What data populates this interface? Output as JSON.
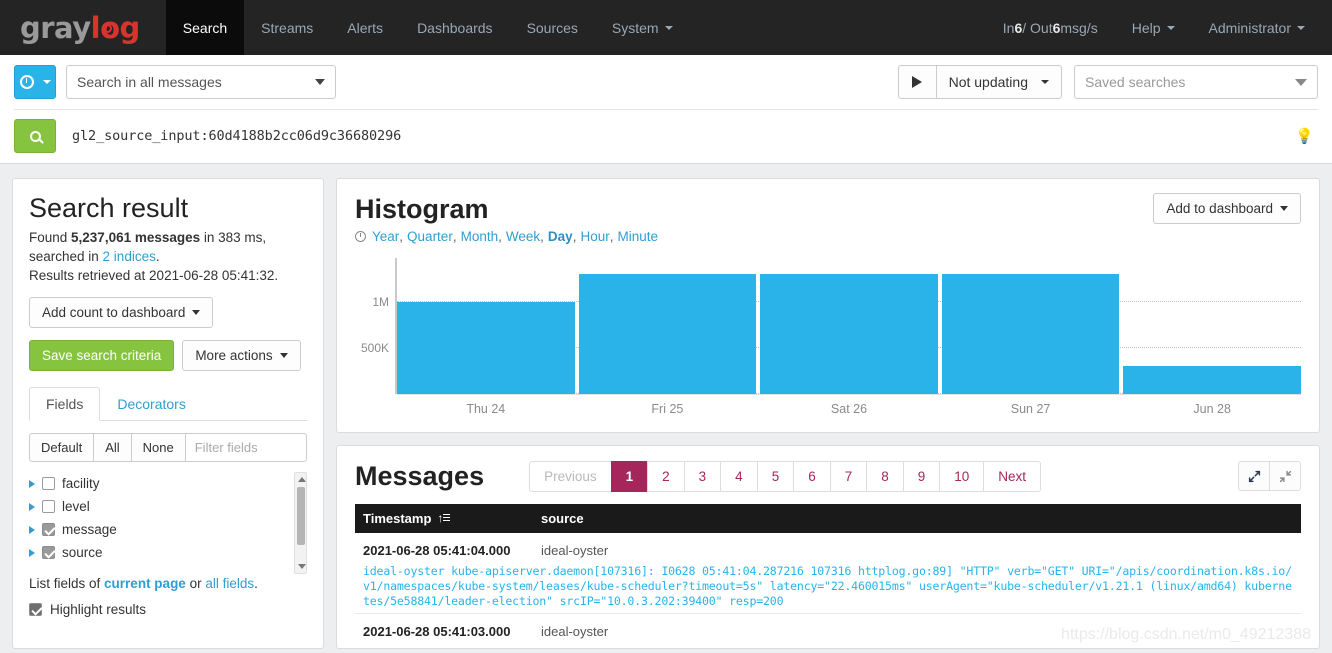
{
  "navbar": {
    "brand": "graylog",
    "brand_part1": "gray",
    "brand_part2": "log",
    "links": [
      {
        "label": "Search",
        "active": true
      },
      {
        "label": "Streams",
        "active": false
      },
      {
        "label": "Alerts",
        "active": false
      },
      {
        "label": "Dashboards",
        "active": false
      },
      {
        "label": "Sources",
        "active": false
      },
      {
        "label": "System",
        "active": false,
        "caret": true
      }
    ],
    "throughput_prefix": "In ",
    "throughput_in": "6",
    "throughput_mid": " / Out ",
    "throughput_out": "6",
    "throughput_suffix": " msg/s",
    "help": "Help",
    "user": "Administrator"
  },
  "search": {
    "time_range_label": "time-range-selector",
    "scope_value": "Search in all messages",
    "query_value": "gl2_source_input:60d4188b2cc06d9c36680296",
    "refresh_label": "Not updating",
    "saved_searches_placeholder": "Saved searches"
  },
  "sidebar": {
    "title": "Search result",
    "found_prefix": "Found ",
    "found_count": "5,237,061 messages",
    "found_mid": " in 383 ms, searched in ",
    "indices_link": "2 indices",
    "found_suffix": ".",
    "retrieved": "Results retrieved at 2021-06-28 05:41:32.",
    "add_count_button": "Add count to dashboard",
    "save_button": "Save search criteria",
    "more_actions_button": "More actions",
    "tabs": [
      {
        "label": "Fields",
        "active": true
      },
      {
        "label": "Decorators",
        "active": false
      }
    ],
    "field_controls": [
      "Default",
      "All",
      "None"
    ],
    "filter_placeholder": "Filter fields",
    "fields": [
      {
        "name": "facility",
        "checked": false
      },
      {
        "name": "level",
        "checked": false
      },
      {
        "name": "message",
        "checked": true
      },
      {
        "name": "source",
        "checked": true
      }
    ],
    "list_fields_prefix": "List fields of ",
    "list_fields_current": "current page",
    "list_fields_or": " or ",
    "list_fields_all": "all fields",
    "list_fields_suffix": ".",
    "highlight_label": "Highlight results",
    "highlight_checked": true
  },
  "histogram": {
    "title": "Histogram",
    "resolutions": [
      "Year",
      "Quarter",
      "Month",
      "Week",
      "Day",
      "Hour",
      "Minute"
    ],
    "active_resolution": "Day",
    "add_to_dashboard": "Add to dashboard"
  },
  "chart_data": {
    "type": "bar",
    "title": "Histogram",
    "categories": [
      "Thu 24",
      "Fri 25",
      "Sat 26",
      "Sun 27",
      "Jun 28"
    ],
    "values": [
      1000000,
      1310000,
      1310000,
      1310000,
      310000
    ],
    "xlabel": "",
    "ylabel": "",
    "ylim": [
      0,
      1480000
    ],
    "yticks": [
      500000,
      1000000
    ],
    "ytick_labels": [
      "500K",
      "1M"
    ],
    "grid": true,
    "legend": false,
    "bar_color": "#29b3e8",
    "interval": "Day"
  },
  "messages": {
    "title": "Messages",
    "pagination": {
      "previous": "Previous",
      "pages": [
        "1",
        "2",
        "3",
        "4",
        "5",
        "6",
        "7",
        "8",
        "9",
        "10"
      ],
      "active_page": "1",
      "next": "Next"
    },
    "columns": [
      "Timestamp",
      "source"
    ],
    "rows": [
      {
        "timestamp": "2021-06-28 05:41:04.000",
        "source": "ideal-oyster",
        "message": "ideal-oyster kube-apiserver.daemon[107316]: I0628 05:41:04.287216 107316 httplog.go:89] \"HTTP\" verb=\"GET\" URI=\"/apis/coordination.k8s.io/v1/namespaces/kube-system/leases/kube-scheduler?timeout=5s\" latency=\"22.460015ms\" userAgent=\"kube-scheduler/v1.21.1 (linux/amd64) kubernetes/5e58841/leader-election\" srcIP=\"10.0.3.202:39400\" resp=200"
      },
      {
        "timestamp": "2021-06-28 05:41:03.000",
        "source": "ideal-oyster",
        "message": ""
      }
    ]
  },
  "watermark": "https://blog.csdn.net/m0_49212388"
}
